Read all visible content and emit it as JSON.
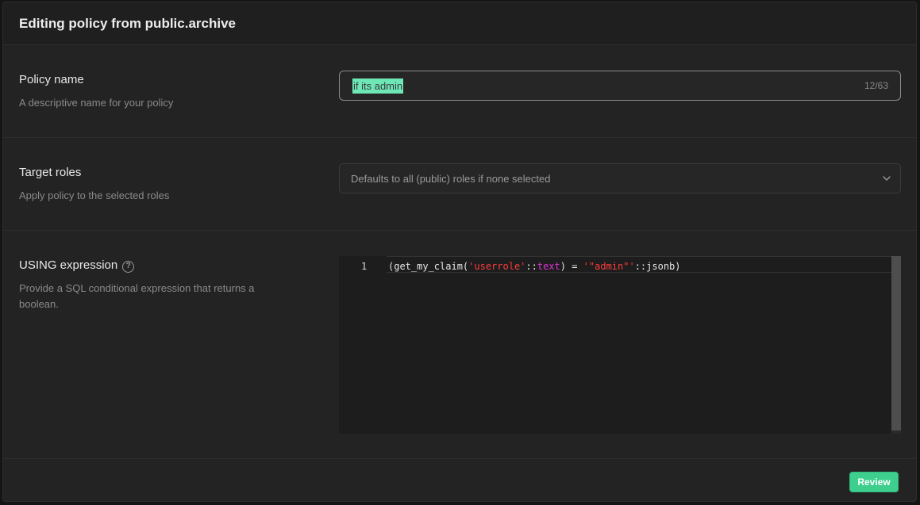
{
  "modal": {
    "title": "Editing policy from public.archive"
  },
  "policy_name": {
    "label": "Policy name",
    "description": "A descriptive name for your policy",
    "value": "if its admin",
    "char_count": "12/63"
  },
  "target_roles": {
    "label": "Target roles",
    "description": "Apply policy to the selected roles",
    "placeholder": "Defaults to all (public) roles if none selected",
    "icon": "chevron-down-icon"
  },
  "using_expression": {
    "label": "USING expression",
    "help_glyph": "?",
    "description": "Provide a SQL conditional expression that returns a boolean.",
    "line_number": "1",
    "code_tokens": [
      {
        "text": "(get_my_claim(",
        "type": "plain"
      },
      {
        "text": "'userrole'",
        "type": "str"
      },
      {
        "text": "::",
        "type": "plain"
      },
      {
        "text": "text",
        "type": "kw"
      },
      {
        "text": ") = ",
        "type": "plain"
      },
      {
        "text": "'\"admin\"'",
        "type": "str"
      },
      {
        "text": "::jsonb)",
        "type": "plain"
      }
    ]
  },
  "footer": {
    "review_label": "Review"
  },
  "colors": {
    "accent": "#3ecf8e",
    "selection": "#6ee7b7",
    "string": "#ff3b3b",
    "keyword": "#e234d8"
  }
}
